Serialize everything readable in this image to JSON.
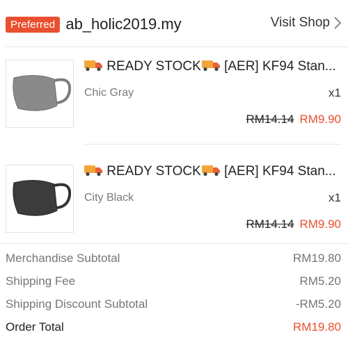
{
  "shop": {
    "badge": "Preferred",
    "name": "ab_holic2019.my",
    "visit_label": "Visit Shop"
  },
  "items": [
    {
      "title_part1": " READY STOCK",
      "title_part2": " [AER] KF94 Stan...",
      "variant": "Chic Gray",
      "quantity": "x1",
      "original_price": "RM14.14",
      "price": "RM9.90",
      "thumb_color": "#808080",
      "thumb_icon": "mask-icon"
    },
    {
      "title_part1": " READY STOCK",
      "title_part2": " [AER] KF94 Stan...",
      "variant": "City Black",
      "quantity": "x1",
      "original_price": "RM14.14",
      "price": "RM9.90",
      "thumb_color": "#3c3c3c",
      "thumb_icon": "mask-icon"
    }
  ],
  "summary": {
    "merchandise_label": "Merchandise Subtotal",
    "merchandise_value": "RM19.80",
    "shipping_label": "Shipping Fee",
    "shipping_value": "RM5.20",
    "shipping_discount_label": "Shipping Discount Subtotal",
    "shipping_discount_value": "-RM5.20",
    "total_label": "Order Total",
    "total_value": "RM19.80"
  },
  "colors": {
    "accent": "#e9502f",
    "truck": "#f2a63a"
  }
}
